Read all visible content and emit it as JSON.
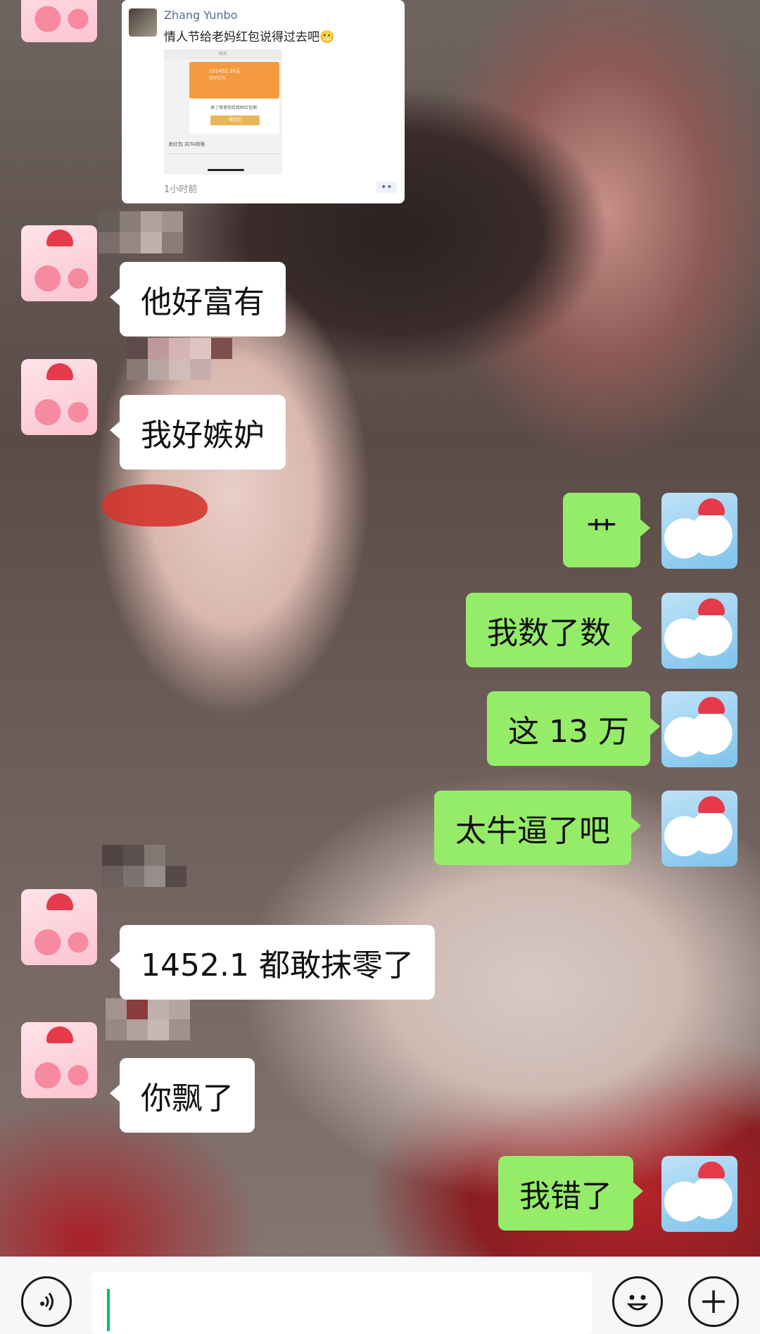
{
  "chat": {
    "shared_card": {
      "author": "Zhang Yunbo",
      "text": "情人节给老妈红包说得过去吧😬",
      "time": "1小时前",
      "more": "••",
      "screenshot": {
        "top_bar": "聊天",
        "amount": "131452.10元",
        "amount_sub": "拜年红包",
        "panel_text": "来了哥哥你给我转红包啊",
        "button": "收红包",
        "links": "发红包   向TA转账"
      }
    },
    "messages": [
      {
        "side": "left",
        "text": "他好富有"
      },
      {
        "side": "left",
        "text": "我好嫉妒"
      },
      {
        "side": "right",
        "text": "艹"
      },
      {
        "side": "right",
        "text": "我数了数"
      },
      {
        "side": "right",
        "text": "这 13 万"
      },
      {
        "side": "right",
        "text": "太牛逼了吧"
      },
      {
        "side": "left",
        "text": "1452.1 都敢抹零了"
      },
      {
        "side": "left",
        "text": "你飘了"
      },
      {
        "side": "right",
        "text": "我错了"
      }
    ]
  },
  "input_bar": {
    "voice_icon": "voice-icon",
    "emoji_icon": "emoji-icon",
    "plus_icon": "plus-icon",
    "value": ""
  },
  "colors": {
    "right_bubble": "#95ec69",
    "left_bubble": "#ffffff",
    "caret": "#07c160"
  }
}
